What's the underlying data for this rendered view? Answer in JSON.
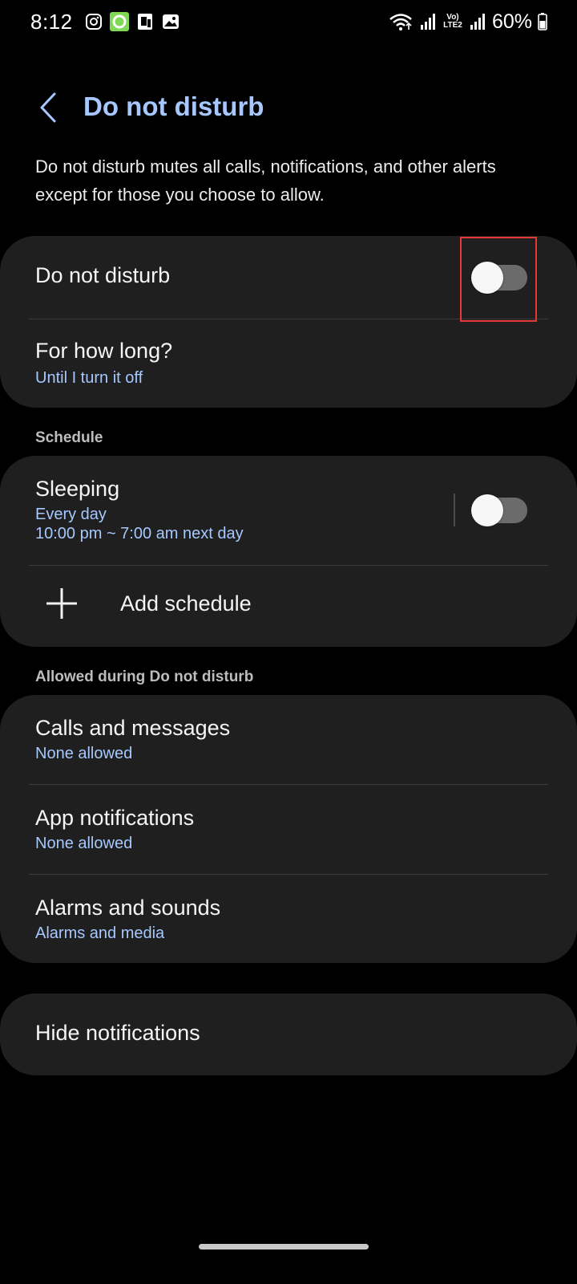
{
  "status_bar": {
    "time": "8:12",
    "network_label": "Vo) LTE2",
    "battery": "60%",
    "left_icons": [
      "instagram-icon",
      "messaging-icon",
      "phone-sync-icon",
      "gallery-icon"
    ],
    "right_icons": [
      "wifi-icon",
      "signal-icon",
      "signal-icon",
      "battery-icon"
    ]
  },
  "header": {
    "title": "Do not disturb"
  },
  "description": "Do not disturb mutes all calls, notifications, and other alerts except for those you choose to allow.",
  "main_card": {
    "dnd_label": "Do not disturb",
    "dnd_enabled": false,
    "duration_title": "For how long?",
    "duration_value": "Until I turn it off"
  },
  "schedule": {
    "section_label": "Schedule",
    "sleeping_title": "Sleeping",
    "sleeping_days": "Every day",
    "sleeping_time": "10:00 pm ~ 7:00 am next day",
    "sleeping_enabled": false,
    "add_label": "Add schedule"
  },
  "allowed": {
    "section_label": "Allowed during Do not disturb",
    "items": [
      {
        "title": "Calls and messages",
        "sub": "None allowed"
      },
      {
        "title": "App notifications",
        "sub": "None allowed"
      },
      {
        "title": "Alarms and sounds",
        "sub": "Alarms and media"
      }
    ]
  },
  "hide_notifications": "Hide notifications",
  "colors": {
    "accent": "#a6c8ff",
    "card": "#1f1f1f",
    "background": "#000000",
    "toggle_off": "#6b6b6b",
    "highlight": "#e53935"
  }
}
